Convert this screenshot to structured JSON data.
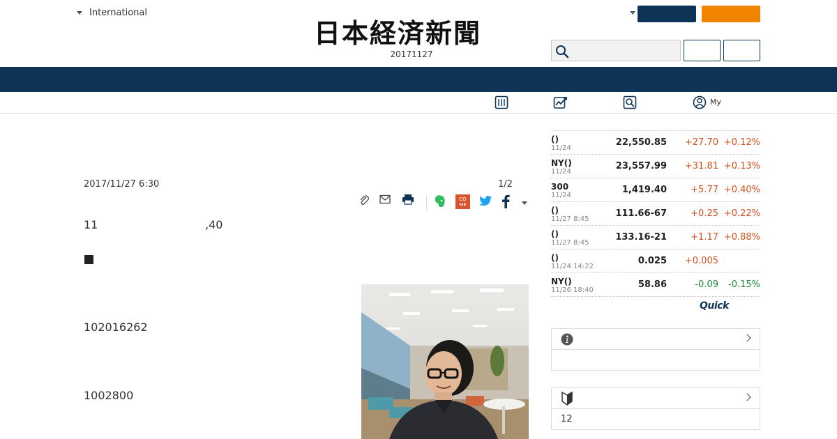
{
  "header": {
    "edition_label": "International",
    "logo_text": "日本経済新聞",
    "date": "20171127",
    "search_placeholder": ""
  },
  "subnav": {
    "my_label": "My"
  },
  "article": {
    "published": "2017/11/27 6:30",
    "page_indicator": "1/2",
    "para1_a": "11",
    "para1_b": ",40",
    "para2": "102016262",
    "para3": "1002800"
  },
  "market": {
    "rows": [
      {
        "name": "()",
        "time": "11/24",
        "value": "22,550.85",
        "change": "+27.70",
        "pct": "+0.12%",
        "dir": "up"
      },
      {
        "name": "NY()",
        "time": "11/24",
        "value": "23,557.99",
        "change": "+31.81",
        "pct": "+0.13%",
        "dir": "up"
      },
      {
        "name": "300",
        "time": "11/24",
        "value": "1,419.40",
        "change": "+5.77",
        "pct": "+0.40%",
        "dir": "up"
      },
      {
        "name": "()",
        "time": "11/27 8:45",
        "value": "111.66-67",
        "change": "+0.25",
        "pct": "+0.22%",
        "dir": "up"
      },
      {
        "name": "()",
        "time": "11/27 8:45",
        "value": "133.16-21",
        "change": "+1.17",
        "pct": "+0.88%",
        "dir": "up"
      },
      {
        "name": "()",
        "time": "11/24 14:22",
        "value": "0.025",
        "change": "+0.005",
        "pct": "",
        "dir": "up"
      },
      {
        "name": "NY()",
        "time": "11/26 18:40",
        "value": "58.86",
        "change": "-0.09",
        "pct": "-0.15%",
        "dir": "down"
      }
    ],
    "provider": "Quick"
  },
  "sidebar": {
    "box2_text": "12"
  },
  "colors": {
    "navy": "#0d3357",
    "orange": "#f08300",
    "up": "#d2501e",
    "down": "#1a8a3a"
  }
}
